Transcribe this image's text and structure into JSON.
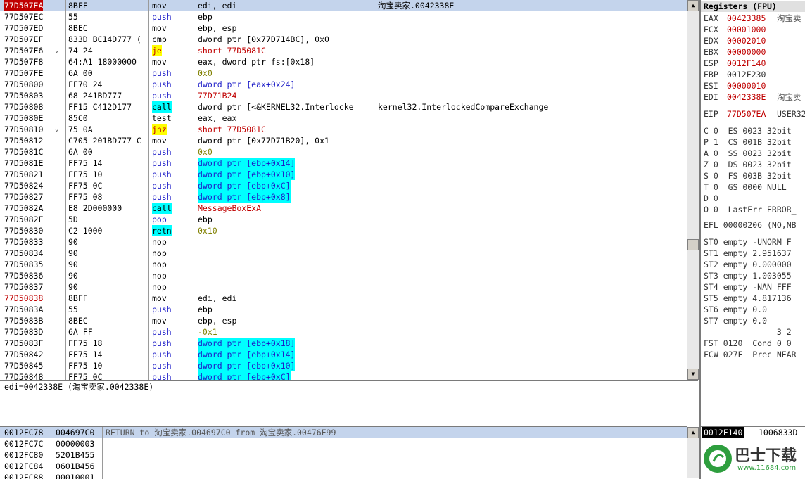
{
  "disasm": {
    "rows": [
      {
        "addr": "77D507EA",
        "hex": "8BFF",
        "mn": "mov",
        "op": "edi, edi",
        "cm": "淘宝卖家.0042338E",
        "sel": true
      },
      {
        "addr": "77D507EC",
        "hex": "55",
        "mn": "push",
        "op": "ebp"
      },
      {
        "addr": "77D507ED",
        "hex": "8BEC",
        "mn": "mov",
        "op": "ebp, esp"
      },
      {
        "addr": "77D507EF",
        "hex": "833D BC14D777 (",
        "mn": "cmp",
        "op": "dword ptr [0x77D714BC], 0x0"
      },
      {
        "addr": "77D507F6",
        "hex": "74 24",
        "mn": "je",
        "op": "short 77D5081C",
        "arr": "⌄"
      },
      {
        "addr": "77D507F8",
        "hex": "64:A1 18000000",
        "mn": "mov",
        "op": "eax, dword ptr fs:[0x18]"
      },
      {
        "addr": "77D507FE",
        "hex": "6A 00",
        "mn": "push",
        "op": "0x0"
      },
      {
        "addr": "77D50800",
        "hex": "FF70 24",
        "mn": "push",
        "op": "dword ptr [eax+0x24]"
      },
      {
        "addr": "77D50803",
        "hex": "68 241BD777",
        "mn": "push",
        "op": "77D71B24"
      },
      {
        "addr": "77D50808",
        "hex": "FF15 C412D177",
        "mn": "call",
        "op": "dword ptr [<&KERNEL32.Interlocke",
        "cm": "kernel32.InterlockedCompareExchange"
      },
      {
        "addr": "77D5080E",
        "hex": "85C0",
        "mn": "test",
        "op": "eax, eax"
      },
      {
        "addr": "77D50810",
        "hex": "75 0A",
        "mn": "jnz",
        "op": "short 77D5081C",
        "arr": "⌄"
      },
      {
        "addr": "77D50812",
        "hex": "C705 201BD777 C",
        "mn": "mov",
        "op": "dword ptr [0x77D71B20], 0x1"
      },
      {
        "addr": "77D5081C",
        "hex": "6A 00",
        "mn": "push",
        "op": "0x0"
      },
      {
        "addr": "77D5081E",
        "hex": "FF75 14",
        "mn": "push",
        "op": "dword ptr [ebp+0x14]"
      },
      {
        "addr": "77D50821",
        "hex": "FF75 10",
        "mn": "push",
        "op": "dword ptr [ebp+0x10]"
      },
      {
        "addr": "77D50824",
        "hex": "FF75 0C",
        "mn": "push",
        "op": "dword ptr [ebp+0xC]"
      },
      {
        "addr": "77D50827",
        "hex": "FF75 08",
        "mn": "push",
        "op": "dword ptr [ebp+0x8]"
      },
      {
        "addr": "77D5082A",
        "hex": "E8 2D000000",
        "mn": "call",
        "op": "MessageBoxExA"
      },
      {
        "addr": "77D5082F",
        "hex": "5D",
        "mn": "pop",
        "op": "ebp"
      },
      {
        "addr": "77D50830",
        "hex": "C2 1000",
        "mn": "retn",
        "op": "0x10"
      },
      {
        "addr": "77D50833",
        "hex": "90",
        "mn": "nop",
        "op": ""
      },
      {
        "addr": "77D50834",
        "hex": "90",
        "mn": "nop",
        "op": ""
      },
      {
        "addr": "77D50835",
        "hex": "90",
        "mn": "nop",
        "op": ""
      },
      {
        "addr": "77D50836",
        "hex": "90",
        "mn": "nop",
        "op": ""
      },
      {
        "addr": "77D50837",
        "hex": "90",
        "mn": "nop",
        "op": ""
      },
      {
        "addr": "77D50838",
        "hex": "8BFF",
        "mn": "mov",
        "op": "edi, edi"
      },
      {
        "addr": "77D5083A",
        "hex": "55",
        "mn": "push",
        "op": "ebp"
      },
      {
        "addr": "77D5083B",
        "hex": "8BEC",
        "mn": "mov",
        "op": "ebp, esp"
      },
      {
        "addr": "77D5083D",
        "hex": "6A FF",
        "mn": "push",
        "op": "-0x1"
      },
      {
        "addr": "77D5083F",
        "hex": "FF75 18",
        "mn": "push",
        "op": "dword ptr [ebp+0x18]"
      },
      {
        "addr": "77D50842",
        "hex": "FF75 14",
        "mn": "push",
        "op": "dword ptr [ebp+0x14]"
      },
      {
        "addr": "77D50845",
        "hex": "FF75 10",
        "mn": "push",
        "op": "dword ptr [ebp+0x10]"
      },
      {
        "addr": "77D50848",
        "hex": "FF75 0C",
        "mn": "push",
        "op": "dword ptr [ebp+0xC]"
      }
    ]
  },
  "info": {
    "text": "edi=0042338E (淘宝卖家.0042338E)"
  },
  "stack": {
    "rows": [
      {
        "addr": "0012FC78",
        "val": "004697C0",
        "cm": "RETURN to 淘宝卖家.004697C0 from 淘宝卖家.00476F99",
        "sel": true
      },
      {
        "addr": "0012FC7C",
        "val": "00000003",
        "cm": ""
      },
      {
        "addr": "0012FC80",
        "val": "5201B455",
        "cm": ""
      },
      {
        "addr": "0012FC84",
        "val": "0601B456",
        "cm": ""
      },
      {
        "addr": "0012FC88",
        "val": "00010001",
        "cm": ""
      }
    ]
  },
  "registers": {
    "title": "Registers (FPU)",
    "gpr": [
      {
        "name": "EAX",
        "val": "00423385",
        "cm": "淘宝卖",
        "red": true
      },
      {
        "name": "ECX",
        "val": "00001000",
        "cm": "",
        "red": true
      },
      {
        "name": "EDX",
        "val": "00002010",
        "cm": "",
        "red": true
      },
      {
        "name": "EBX",
        "val": "00000000",
        "cm": "",
        "red": true
      },
      {
        "name": "ESP",
        "val": "0012F140",
        "cm": "",
        "red": true
      },
      {
        "name": "EBP",
        "val": "0012F230",
        "cm": "",
        "red": false
      },
      {
        "name": "ESI",
        "val": "00000010",
        "cm": "",
        "red": true
      },
      {
        "name": "EDI",
        "val": "0042338E",
        "cm": "淘宝卖",
        "red": true
      }
    ],
    "eip": {
      "name": "EIP",
      "val": "77D507EA",
      "cm": "USER32"
    },
    "flags": [
      "C 0  ES 0023 32bit",
      "P 1  CS 001B 32bit",
      "A 0  SS 0023 32bit",
      "Z 0  DS 0023 32bit",
      "S 0  FS 003B 32bit",
      "T 0  GS 0000 NULL",
      "D 0",
      "O 0  LastErr ERROR_"
    ],
    "efl": "EFL 00000206 (NO,NB",
    "fpu": [
      "ST0 empty -UNORM F",
      "ST1 empty 2.951637",
      "ST2 empty 0.000000",
      "ST3 empty 1.003055",
      "ST4 empty -NAN FFF",
      "ST5 empty 4.817136",
      "ST6 empty 0.0",
      "ST7 empty 0.0",
      "               3 2",
      "FST 0120  Cond 0 0",
      "FCW 027F  Prec NEAR"
    ]
  },
  "dump": {
    "addr": "0012F140",
    "val": "1006833D"
  },
  "logo": {
    "text": "巴士下载",
    "url": "www.11684.com"
  }
}
